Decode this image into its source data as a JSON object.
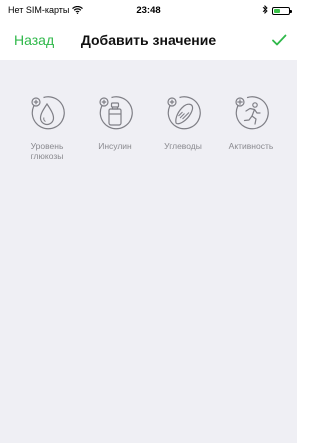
{
  "status_bar": {
    "carrier": "Нет SIM-карты",
    "time": "23:48",
    "wifi_icon": "wifi-icon",
    "bluetooth_icon": "bluetooth-icon",
    "battery_icon": "battery-icon",
    "battery_fill_color": "#3ac34a"
  },
  "nav": {
    "back_label": "Назад",
    "title": "Добавить значение",
    "confirm_icon": "checkmark-icon",
    "accent_color": "#2fb84a"
  },
  "options": [
    {
      "label_line1": "Уровень",
      "label_line2": "глюкозы",
      "icon": "glucose-drop-icon"
    },
    {
      "label_line1": "Инсулин",
      "label_line2": "",
      "icon": "insulin-vial-icon"
    },
    {
      "label_line1": "Углеводы",
      "label_line2": "",
      "icon": "carbs-bread-icon"
    },
    {
      "label_line1": "Активность",
      "label_line2": "",
      "icon": "activity-runner-icon"
    }
  ],
  "colors": {
    "content_background": "#efeff4",
    "icon_stroke": "#7f7f86",
    "label_text": "#8a8a8f"
  }
}
